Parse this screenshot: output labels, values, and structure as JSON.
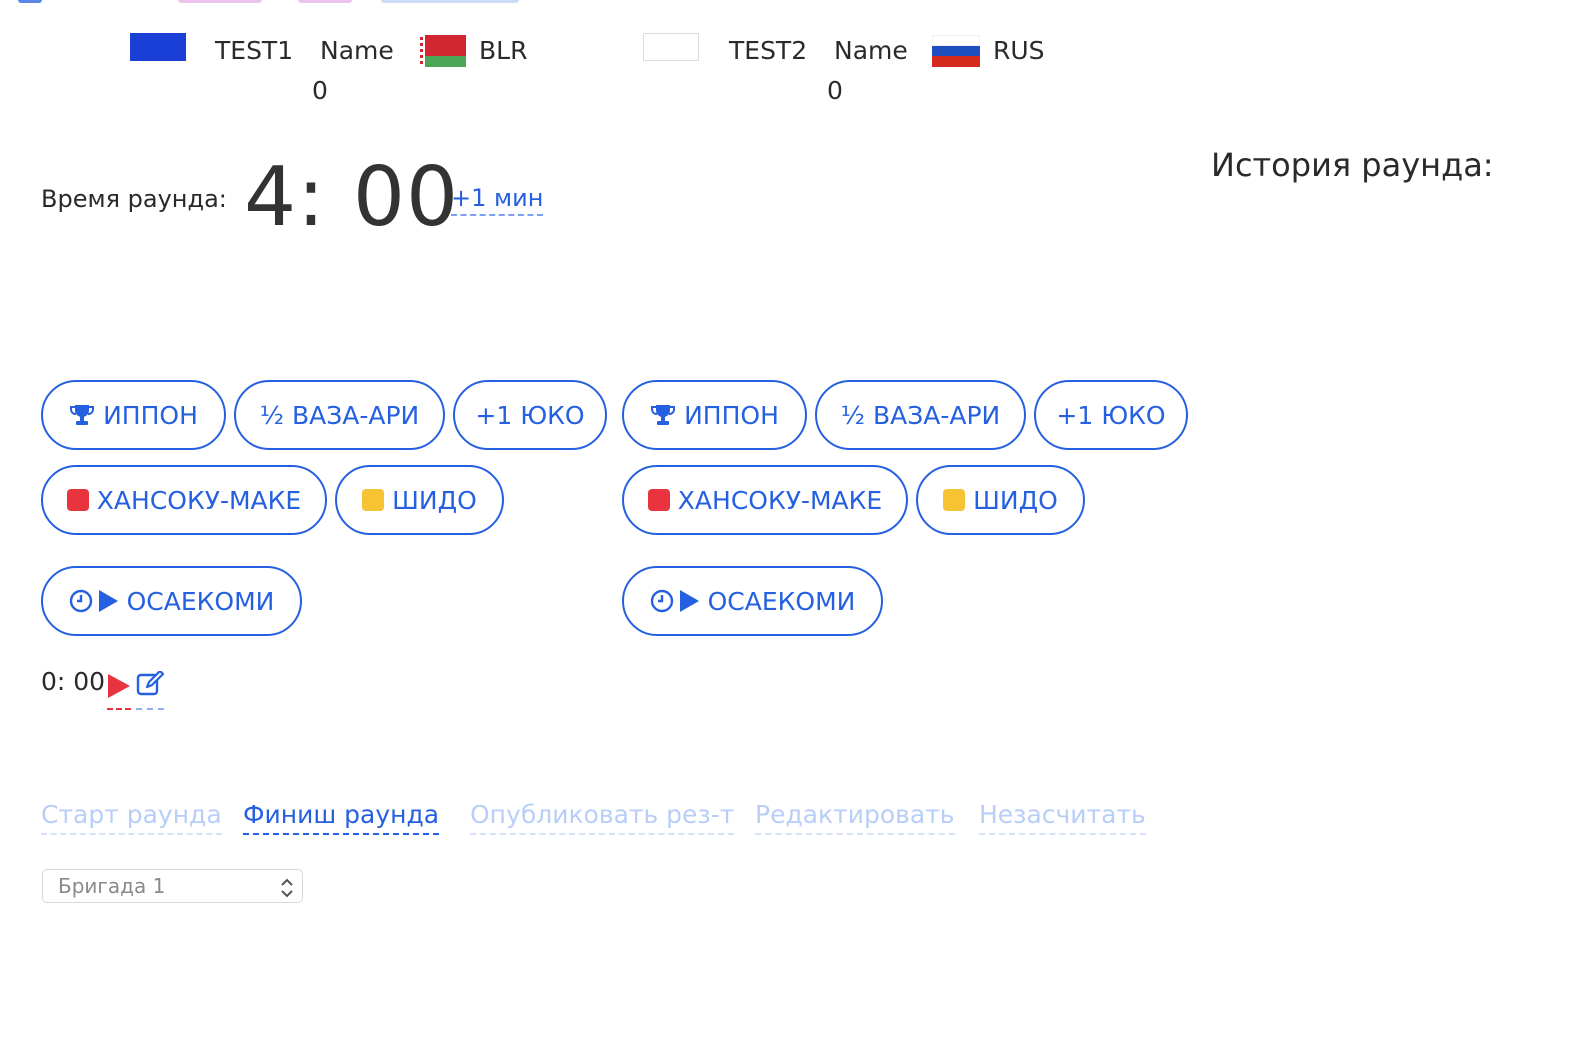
{
  "players": [
    {
      "name": "TEST1",
      "club": "Name",
      "country": "BLR",
      "score": "0",
      "color": "#1a3fd6"
    },
    {
      "name": "TEST2",
      "club": "Name",
      "country": "RUS",
      "score": "0",
      "color": "#ffffff"
    }
  ],
  "round": {
    "label": "Время раунда:",
    "timer": "4: 00",
    "add_minute": "+1 мин",
    "history_title": "История раунда:"
  },
  "actions": {
    "ippon": "ИППОН",
    "wazaari": "½ ВАЗА-АРИ",
    "yuko": "+1 ЮКО",
    "hansoku": "ХАНСОКУ-МАКЕ",
    "shido": "ШИДО",
    "osaekomi": "ОСАЕКОМИ"
  },
  "osaekomi_time": "0: 00",
  "bottom_actions": {
    "start": "Старт раунда",
    "finish": "Финиш раунда",
    "publish": "Опубликовать рез-т",
    "edit": "Редактировать",
    "annul": "Незасчитать"
  },
  "brigade_select": {
    "value": "Бригада 1"
  },
  "colors": {
    "accent": "#2560e0",
    "penalty_red": "#e8343f",
    "shido_yellow": "#f6c335",
    "disabled": "#b8cef8"
  },
  "icons": {
    "ippon": "trophy-icon",
    "hansoku": "red-square-icon",
    "shido": "yellow-square-icon",
    "osaekomi": [
      "clock-icon",
      "play-icon"
    ],
    "osaekomi_controls": [
      "play-icon-red",
      "edit-icon"
    ]
  }
}
